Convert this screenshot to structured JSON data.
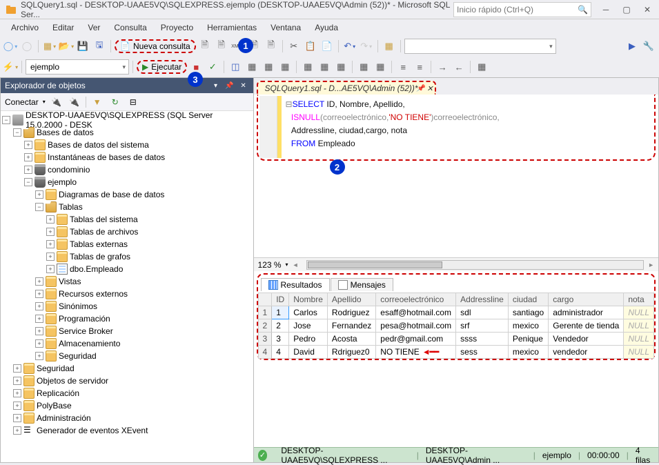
{
  "title": "SQLQuery1.sql - DESKTOP-UAAE5VQ\\SQLEXPRESS.ejemplo (DESKTOP-UAAE5VQ\\Admin (52))* - Microsoft SQL Ser...",
  "quick_launch_placeholder": "Inicio rápido (Ctrl+Q)",
  "menu": [
    "Archivo",
    "Editar",
    "Ver",
    "Consulta",
    "Proyecto",
    "Herramientas",
    "Ventana",
    "Ayuda"
  ],
  "nueva_consulta": "Nueva consulta",
  "ejecutar": "Ejecutar",
  "db_combo": "ejemplo",
  "callouts": {
    "1": "1",
    "2": "2",
    "3": "3"
  },
  "object_explorer": {
    "title": "Explorador de objetos",
    "conectar": "Conectar",
    "server": "DESKTOP-UAAE5VQ\\SQLEXPRESS (SQL Server 15.0.2000 - DESK",
    "nodes": {
      "bases_de_datos": "Bases de datos",
      "bd_sistema": "Bases de datos del sistema",
      "instantaneas": "Instantáneas de bases de datos",
      "condominio": "condominio",
      "ejemplo": "ejemplo",
      "diagramas": "Diagramas de base de datos",
      "tablas": "Tablas",
      "tablas_sistema": "Tablas del sistema",
      "tablas_archivos": "Tablas de archivos",
      "tablas_externas": "Tablas externas",
      "tablas_grafos": "Tablas de grafos",
      "dbo_empleado": "dbo.Empleado",
      "vistas": "Vistas",
      "recursos_ext": "Recursos externos",
      "sinonimos": "Sinónimos",
      "programacion": "Programación",
      "service_broker": "Service Broker",
      "almacenamiento": "Almacenamiento",
      "seguridad_db": "Seguridad",
      "seguridad": "Seguridad",
      "objetos_servidor": "Objetos de servidor",
      "replicacion": "Replicación",
      "polybase": "PolyBase",
      "administracion": "Administración",
      "xevent": "Generador de eventos XEvent"
    }
  },
  "editor_tab": "SQLQuery1.sql - D...AE5VQ\\Admin (52))*",
  "sql": {
    "l1a": "SELECT",
    "l1b": " ID, Nombre, Apellido,",
    "l2a": "ISNULL",
    "l2b": "(correoelectrónico,",
    "l2c": "'NO TIENE'",
    "l2d": ")correoelectrónico,",
    "l3": "Addressline, ciudad,cargo, nota",
    "l4a": "FROM",
    "l4b": " Empleado"
  },
  "zoom": "123 %",
  "result_tabs": {
    "resultados": "Resultados",
    "mensajes": "Mensajes"
  },
  "grid": {
    "headers": [
      "",
      "ID",
      "Nombre",
      "Apellido",
      "correoelectrónico",
      "Addressline",
      "ciudad",
      "cargo",
      "nota"
    ],
    "rows": [
      [
        "1",
        "1",
        "Carlos",
        "Rodriguez",
        "esaff@hotmail.com",
        "sdl",
        "santiago",
        "administrador",
        "NULL"
      ],
      [
        "2",
        "2",
        "Jose",
        "Fernandez",
        "pesa@hotmail.com",
        "srf",
        "mexico",
        "Gerente de tienda",
        "NULL"
      ],
      [
        "3",
        "3",
        "Pedro",
        "Acosta",
        "pedr@gmail.com",
        "ssss",
        "Penique",
        "Vendedor",
        "NULL"
      ],
      [
        "4",
        "4",
        "David",
        "Rdriguez0",
        "NO TIENE",
        "sess",
        "mexico",
        "vendedor",
        "NULL"
      ]
    ]
  },
  "status": {
    "conn": "DESKTOP-UAAE5VQ\\SQLEXPRESS ...",
    "user": "DESKTOP-UAAE5VQ\\Admin ...",
    "db": "ejemplo",
    "time": "00:00:00",
    "rows": "4 filas"
  }
}
